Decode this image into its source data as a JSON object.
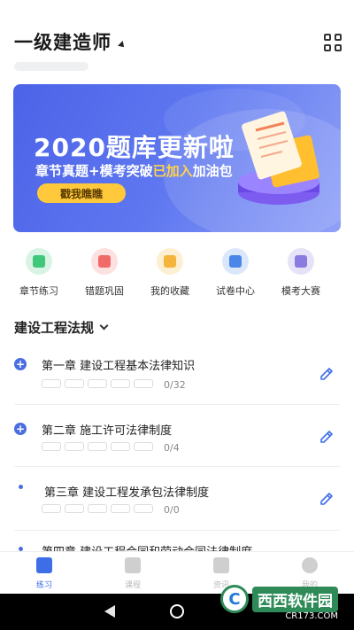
{
  "header": {
    "title": "一级建造师"
  },
  "banner": {
    "headline": "2020题库更新啦",
    "sub_part1": "章节真题+模考突破",
    "sub_highlight": "已加入",
    "sub_part2": "加油包",
    "button": "戳我瞧瞧"
  },
  "quick_actions": [
    {
      "label": "章节练习",
      "icon": "pencil-icon",
      "color": "#3fc77a"
    },
    {
      "label": "错题巩固",
      "icon": "stack-icon",
      "color": "#f06a6a"
    },
    {
      "label": "我的收藏",
      "icon": "star-icon",
      "color": "#f5b53c"
    },
    {
      "label": "试卷中心",
      "icon": "books-icon",
      "color": "#4a86e8"
    },
    {
      "label": "模考大赛",
      "icon": "paper-icon",
      "color": "#8a7be0"
    }
  ],
  "section": {
    "title": "建设工程法规"
  },
  "chapters": [
    {
      "title": "第一章 建设工程基本法律知识",
      "count": "0/32",
      "marker": "plus"
    },
    {
      "title": "第二章 施工许可法律制度",
      "count": "0/4",
      "marker": "plus"
    },
    {
      "title": "第三章 建设工程发承包法律制度",
      "count": "0/0",
      "marker": "dot"
    },
    {
      "title": "第四章 建设工程合同和劳动合同法律制度",
      "count": "",
      "marker": "dot"
    }
  ],
  "bottom_nav": [
    {
      "label": "练习",
      "active": true
    },
    {
      "label": "课程",
      "active": false
    },
    {
      "label": "资讯",
      "active": false
    },
    {
      "label": "我的",
      "active": false
    }
  ],
  "watermark": {
    "logo": "C",
    "text": "西西软件园",
    "url": "CR173.COM"
  },
  "colors": {
    "accent": "#3d6ee8",
    "banner": "#5b72ee"
  }
}
